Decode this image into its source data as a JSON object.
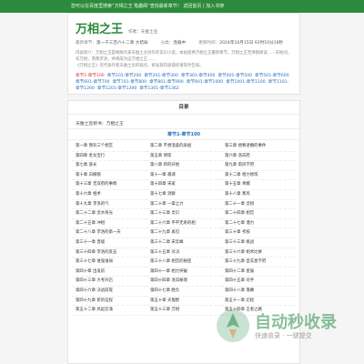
{
  "topbar": {
    "text": "您可以在百度里搜索“万相之王 笔趣阁”查找最新章节！ 返回首页 | 加入书架"
  },
  "book": {
    "title": "万相之王",
    "author": "作者：天蚕土豆",
    "category_label": "分类：",
    "category": "连载中",
    "update_label": "更新时间：",
    "update_time": "2024年10月15日 02时10分16秒",
    "latest_label": "最新章节：",
    "latest": "第一千三百六十二章 大结局",
    "intro": "内容简介：万相之王是网络作家天蚕土豆创作的玄幻小说，本站提供万相之王最新章节，万相之王无弹窗阅读……天地间，有万相，而我李洛，终将成为这万相之王……",
    "intro2": "《万相之王》仅代表作者天蚕土豆的观点，如发现内容侵权请及时告知。",
    "ranges": [
      {
        "label": "章节1-章节100",
        "active": true
      },
      {
        "label": "章节101-章节200",
        "active": false
      },
      {
        "label": "章节201-章节300",
        "active": false
      },
      {
        "label": "章节301-章节400",
        "active": false
      },
      {
        "label": "章节401-章节500",
        "active": false
      },
      {
        "label": "章节501-章节600",
        "active": false
      },
      {
        "label": "章节601-章节700",
        "active": false
      },
      {
        "label": "章节701-章节800",
        "active": false
      },
      {
        "label": "章节801-章节900",
        "active": false
      },
      {
        "label": "章节901-章节1000",
        "active": false
      },
      {
        "label": "章节1001-章节1100",
        "active": false
      },
      {
        "label": "章节1101-章节1200",
        "active": false
      },
      {
        "label": "章节1201-章节1300",
        "active": false
      },
      {
        "label": "章节1301-章节1362",
        "active": false
      }
    ]
  },
  "list": {
    "title": "目录",
    "latest_text": "天蚕土豆新书：万相之王",
    "section": "章节1-章节100",
    "chapters": [
      "第一章 我有三个相宫",
      "第二章 不想温柔的表姐",
      "第三章 想要退婚的事件",
      "第四章 金龙宝行",
      "第五章 修炼",
      "第六章 洛岚府",
      "第七章 族长",
      "第八章 新的开始",
      "第九章 南风学府",
      "第十章 白眼狼",
      "第十一章 邀请",
      "第十二章 相力修炼",
      "第十三章 无双府的事情",
      "第十四章 宋家",
      "第十五章 青娥",
      "第十六章 相术",
      "第十七章 洞察",
      "第十八章 寒风",
      "第十九章 李洛的气",
      "第二十章 一掌之力",
      "第二十一章 灵相",
      "第二十二章 灵水奇光",
      "第二十三章 灵识",
      "第二十四章 相宫",
      "第二十五章 冲相",
      "第二十六章 平平无奇的相",
      "第二十七章 潜力",
      "第二十八章 李洛的第一天",
      "第二十九章 再见",
      "第三十章 考核",
      "第三十一章 晋级",
      "第三十二章 宋云峰",
      "第三十三章 挑战",
      "第三十四章 李洛的反击",
      "第三十五章 对决",
      "第三十六章 相术比拼",
      "第三十七章 谁强谁弱",
      "第三十八章 相宫的秘密",
      "第三十九章 圣玄星学府",
      "第四十章 出发前",
      "第四十一章 相力突破",
      "第四十二章 星辰",
      "第四十三章 大考开启",
      "第四十四章 洛岚秘境",
      "第四十五章 对手",
      "第四十六章 决战前夜",
      "第四十七章 胜负",
      "第四十八章 落幕",
      "第四十九章 新的征程",
      "第五十章 天蜀郡",
      "第五十一章 启程",
      "第五十二章 风起云涌",
      "第五十三章 万相",
      "第五十四章 王者之路"
    ]
  },
  "watermark": {
    "text": "自动秒收录",
    "sub": "快速收录 · 一键提交"
  },
  "colors": {
    "accent": "#2c8a3c",
    "link": "#2a6fbf"
  }
}
